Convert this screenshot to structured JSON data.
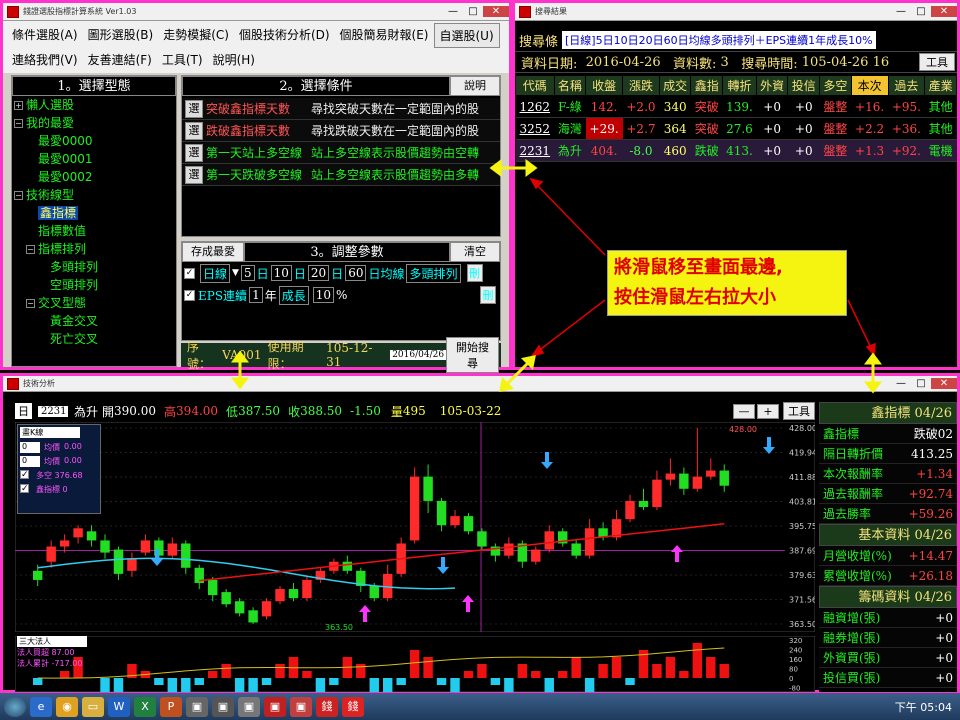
{
  "window1": {
    "title": "錢證選股指標計算系統 Ver1.03",
    "menu": [
      "條件選股(A)",
      "圖形選股(B)",
      "走勢模擬(C)",
      "個股技術分析(D)",
      "個股簡易財報(E)",
      "自選股(U)",
      "連絡我們(V)",
      "友善連結(F)",
      "工具(T)",
      "說明(H)"
    ],
    "panel1_title": "1。選擇型態",
    "tree": [
      {
        "label": "懶人選股",
        "level": 0,
        "pm": "+"
      },
      {
        "label": "我的最愛",
        "level": 0,
        "pm": "-"
      },
      {
        "label": "最愛0000",
        "level": 2
      },
      {
        "label": "最愛0001",
        "level": 2
      },
      {
        "label": "最愛0002",
        "level": 2
      },
      {
        "label": "技術線型",
        "level": 0,
        "pm": "-"
      },
      {
        "label": "鑫指標",
        "level": 2,
        "selected": true
      },
      {
        "label": "指標數值",
        "level": 2
      },
      {
        "label": "指標排列",
        "level": 1,
        "pm": "-"
      },
      {
        "label": "多頭排列",
        "level": 3
      },
      {
        "label": "空頭排列",
        "level": 3
      },
      {
        "label": "交叉型態",
        "level": 1,
        "pm": "-"
      },
      {
        "label": "黃金交叉",
        "level": 3
      },
      {
        "label": "死亡交叉",
        "level": 3
      }
    ],
    "panel2_title": "2。選擇條件",
    "help_label": "說明",
    "conditions": [
      {
        "btn": "選",
        "name": "突破鑫指標天數",
        "desc": "尋找突破天數在一定範圍內的股",
        "color": "red"
      },
      {
        "btn": "選",
        "name": "跌破鑫指標天數",
        "desc": "尋找跌破天數在一定範圍內的股",
        "color": "red"
      },
      {
        "btn": "選",
        "name": "第一天站上多空線",
        "desc": "站上多空線表示股價趨勢由空轉",
        "color": "green"
      },
      {
        "btn": "選",
        "name": "第一天跌破多空線",
        "desc": "站上多空線表示股價趨勢由多轉",
        "color": "green"
      }
    ],
    "save_fav": "存成最愛",
    "panel3_title": "3。調整參數",
    "clear_label": "清空",
    "params1": {
      "period": "日線",
      "ma": [
        "5",
        "日",
        "10",
        "日",
        "20",
        "日",
        "60",
        "日均線"
      ],
      "order": "多頭排列",
      "del": "刪"
    },
    "params2": {
      "name": "EPS連續",
      "years": "1",
      "unit": "年",
      "type": "成長",
      "pct": "10",
      "pct_unit": "%",
      "del": "刪"
    },
    "status": {
      "serial_label": "序號：",
      "serial": "VA001",
      "expiry_label": "使用期限：",
      "expiry": "105-12-31",
      "date": "2016/04/26",
      "search_btn": "開始搜尋"
    }
  },
  "window2": {
    "title": "搜尋結果",
    "criteria_label": "搜尋條",
    "criteria": "[日線]5日10日20日60日均線多頭排列＋EPS連續1年成長10%",
    "date_label": "資料日期:",
    "date": "2016-04-26",
    "count_label": "資料數:",
    "count": "3",
    "time_label": "搜尋時間:",
    "time": "105-04-26 16",
    "tool_btn": "工具",
    "columns": [
      "代碼",
      "名稱",
      "收盤",
      "漲跌",
      "成交",
      "鑫指",
      "轉折",
      "外資",
      "投信",
      "多空",
      "本次",
      "過去",
      "產業"
    ],
    "rows": [
      [
        "1262",
        "F-綠",
        "142.",
        "+2.0",
        "340",
        "突破",
        "139.",
        "+0",
        "+0",
        "盤整",
        "+16.",
        "+95.",
        "其他"
      ],
      [
        "3252",
        "海灣",
        "+29.",
        "+2.7",
        "364",
        "突破",
        "27.6",
        "+0",
        "+0",
        "盤整",
        "+2.2",
        "+36.",
        "其他"
      ],
      [
        "2231",
        "為升",
        "404.",
        "-8.0",
        "460",
        "跌破",
        "413.",
        "+0",
        "+0",
        "盤整",
        "+1.3",
        "+92.",
        "電機"
      ]
    ]
  },
  "window3": {
    "title": "技術分析",
    "period": "日",
    "code": "2231",
    "name": "為升",
    "open_label": "開",
    "open": "390.00",
    "high_label": "高",
    "high": "394.00",
    "low_label": "低",
    "low": "387.50",
    "close_label": "收",
    "close": "388.50",
    "change": "-1.50",
    "vol_label": "量",
    "vol": "495",
    "date": "105-03-22",
    "zoom_minus": "—",
    "zoom_plus": "+",
    "tool_btn": "工具",
    "legend_panel": {
      "select": "畫K線",
      "rows": [
        {
          "v": "0",
          "label": "均價",
          "val": "0.00"
        },
        {
          "v": "0",
          "label": "均價",
          "val": "0.00"
        }
      ],
      "p1": "多空 376.68",
      "p2": "鑫指標 0"
    },
    "price_labels": [
      "428.00",
      "419.94",
      "411.88",
      "403.81",
      "395.75",
      "387.69",
      "379.63",
      "371.56",
      "363.50"
    ],
    "peak_label": "428.00",
    "trough_label": "363.50",
    "sub_legend": [
      "三大法人",
      "法人買超 87.00",
      "法人累計 -717.00"
    ],
    "sub_labels": [
      "320",
      "240",
      "160",
      "80",
      "0",
      "-80"
    ],
    "side": {
      "hdr1": "鑫指標",
      "hdr1_date": "04/26",
      "rows1": [
        {
          "l": "鑫指標",
          "v": "跌破02",
          "c": "#ffffff"
        },
        {
          "l": "隔日轉折價",
          "v": "413.25",
          "c": "#ffffff"
        },
        {
          "l": "本次報酬率",
          "v": "+1.34",
          "c": "#ff4444"
        },
        {
          "l": "過去報酬率",
          "v": "+92.74",
          "c": "#ff4444"
        },
        {
          "l": "過去勝率",
          "v": "+59.26",
          "c": "#ff4444"
        }
      ],
      "hdr2": "基本資料",
      "hdr2_date": "04/26",
      "rows2": [
        {
          "l": "月營收增(%)",
          "v": "+14.47",
          "c": "#ff4444"
        },
        {
          "l": "累營收增(%)",
          "v": "+26.18",
          "c": "#ff4444"
        }
      ],
      "hdr3": "籌碼資料",
      "hdr3_date": "04/26",
      "rows3": [
        {
          "l": "融資增(張)",
          "v": "+0",
          "c": "#ffffff"
        },
        {
          "l": "融券增(張)",
          "v": "+0",
          "c": "#ffffff"
        },
        {
          "l": "外資買(張)",
          "v": "+0",
          "c": "#ffffff"
        },
        {
          "l": "投信買(張)",
          "v": "+0",
          "c": "#ffffff"
        }
      ]
    }
  },
  "callout": [
    "將滑鼠移至畫面最邊,",
    "按住滑鼠左右拉大小"
  ],
  "taskbar": {
    "time": "下午 05:04"
  }
}
